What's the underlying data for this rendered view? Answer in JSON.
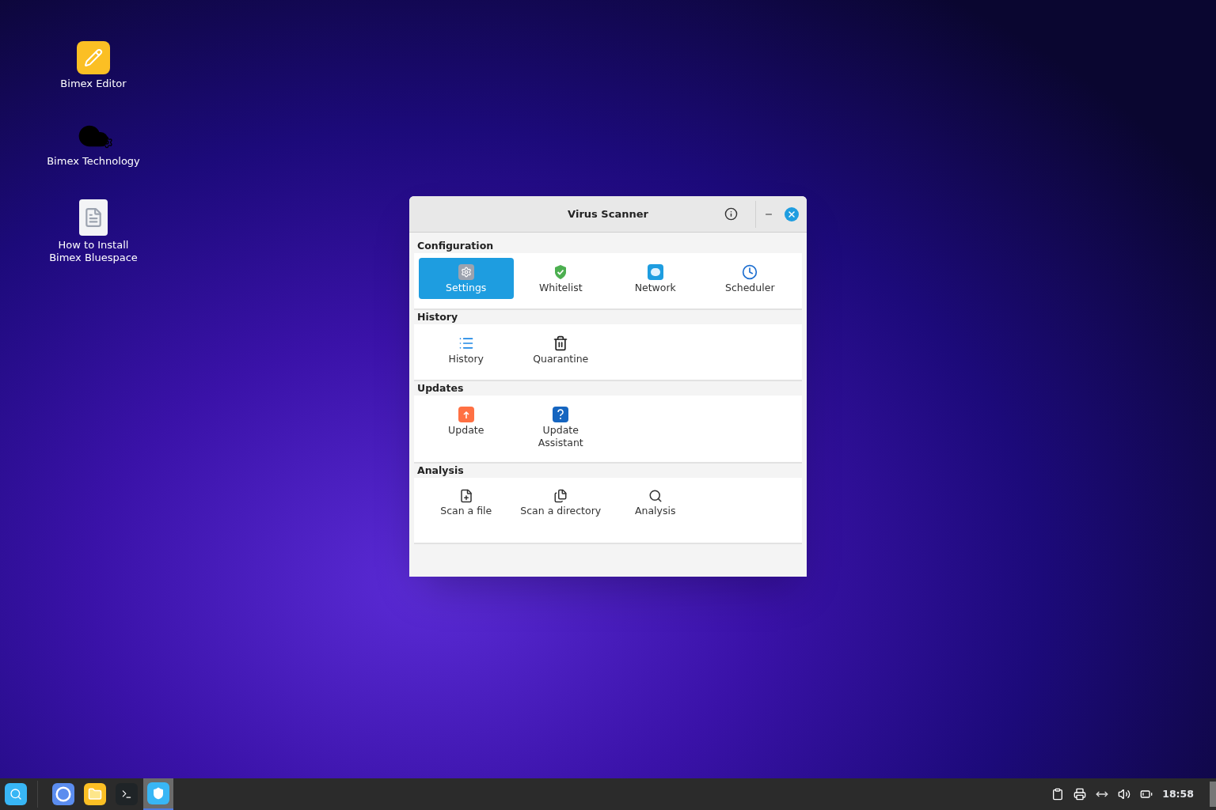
{
  "desktop_icons": [
    {
      "kind": "editor",
      "label": "Bimex Editor"
    },
    {
      "kind": "cloud",
      "label": "Bimex Technology"
    },
    {
      "kind": "document",
      "label": "How to Install Bimex Bluespace"
    }
  ],
  "window": {
    "title": "Virus Scanner",
    "sections": [
      {
        "title": "Configuration",
        "items": [
          {
            "kind": "settings",
            "label": "Settings",
            "selected": true
          },
          {
            "kind": "whitelist",
            "label": "Whitelist",
            "selected": false
          },
          {
            "kind": "network",
            "label": "Network",
            "selected": false
          },
          {
            "kind": "scheduler",
            "label": "Scheduler",
            "selected": false
          }
        ]
      },
      {
        "title": "History",
        "items": [
          {
            "kind": "history",
            "label": "History",
            "selected": false
          },
          {
            "kind": "quarantine",
            "label": "Quarantine",
            "selected": false
          }
        ]
      },
      {
        "title": "Updates",
        "items": [
          {
            "kind": "update",
            "label": "Update",
            "selected": false
          },
          {
            "kind": "assistant",
            "label": "Update Assistant",
            "selected": false
          }
        ]
      },
      {
        "title": "Analysis",
        "items": [
          {
            "kind": "file",
            "label": "Scan a file",
            "selected": false
          },
          {
            "kind": "directory",
            "label": "Scan a directory",
            "selected": false
          },
          {
            "kind": "search",
            "label": "Analysis",
            "selected": false
          }
        ]
      }
    ]
  },
  "taskbar": {
    "apps": [
      {
        "kind": "browser",
        "selected": false
      },
      {
        "kind": "files",
        "selected": false
      },
      {
        "kind": "terminal",
        "selected": false
      },
      {
        "kind": "shield",
        "selected": true
      }
    ],
    "clock": "18:58"
  }
}
